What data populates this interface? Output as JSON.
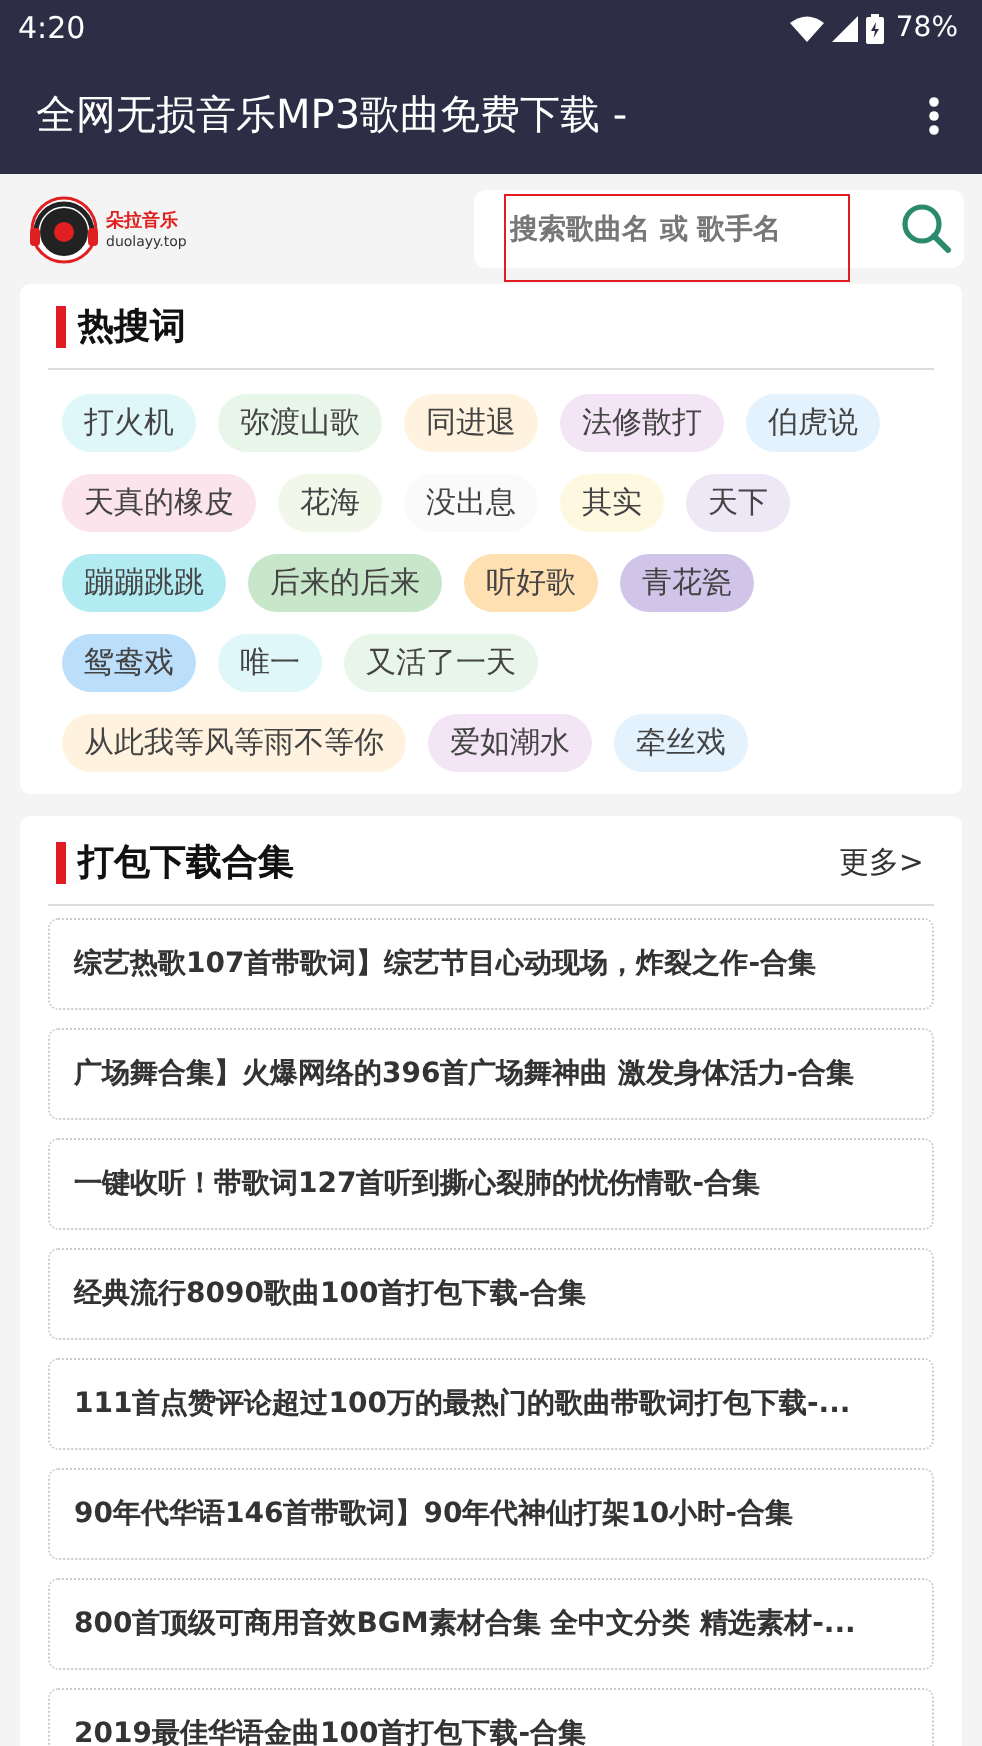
{
  "status_bar": {
    "time": "4:20",
    "battery": "78%"
  },
  "app_bar": {
    "title": "全网无损音乐MP3歌曲免费下载 -"
  },
  "header": {
    "logo_text": "朵拉音乐",
    "logo_domain": "duolayy.top",
    "search": {
      "placeholder": "搜索歌曲名 或 歌手名"
    }
  },
  "hot_words": {
    "title": "热搜词",
    "tags": [
      {
        "label": "打火机",
        "color": "#e0f7fa"
      },
      {
        "label": "弥渡山歌",
        "color": "#e8f5e9"
      },
      {
        "label": "同进退",
        "color": "#fff3e0"
      },
      {
        "label": "法修散打",
        "color": "#f3e5f5"
      },
      {
        "label": "伯虎说",
        "color": "#e3f2fd"
      },
      {
        "label": "天真的橡皮",
        "color": "#fce4ec"
      },
      {
        "label": "花海",
        "color": "#f1f8e9"
      },
      {
        "label": "没出息",
        "color": "#fafafa"
      },
      {
        "label": "其实",
        "color": "#fff8e1"
      },
      {
        "label": "天下",
        "color": "#ede7f6"
      },
      {
        "label": "蹦蹦跳跳",
        "color": "#b2ebf2"
      },
      {
        "label": "后来的后来",
        "color": "#c8e6c9"
      },
      {
        "label": "听好歌",
        "color": "#ffe0b2"
      },
      {
        "label": "青花瓷",
        "color": "#d1c4e9"
      },
      {
        "label": "鸳鸯戏",
        "color": "#bbdefb"
      },
      {
        "label": "唯一",
        "color": "#e0f7fa"
      },
      {
        "label": "又活了一天",
        "color": "#e8f5e9"
      },
      {
        "label": "从此我等风等雨不等你",
        "color": "#fff3e0"
      },
      {
        "label": "爱如潮水",
        "color": "#f3e5f5"
      },
      {
        "label": "牵丝戏",
        "color": "#e3f2fd"
      }
    ]
  },
  "collections": {
    "title": "打包下载合集",
    "more": "更多>",
    "items": [
      "综艺热歌107首带歌词】综艺节目心动现场，炸裂之作-合集",
      "广场舞合集】火爆网络的396首广场舞神曲 激发身体活力-合集",
      "一键收听！带歌词127首听到撕心裂肺的忧伤情歌-合集",
      "经典流行8090歌曲100首打包下载-合集",
      "111首点赞评论超过100万的最热门的歌曲带歌词打包下载-...",
      "90年代华语146首带歌词】90年代神仙打架10小时-合集",
      "800首顶级可商用音效BGM素材合集 全中文分类 精选素材-...",
      "2019最佳华语金曲100首打包下载-合集"
    ]
  }
}
